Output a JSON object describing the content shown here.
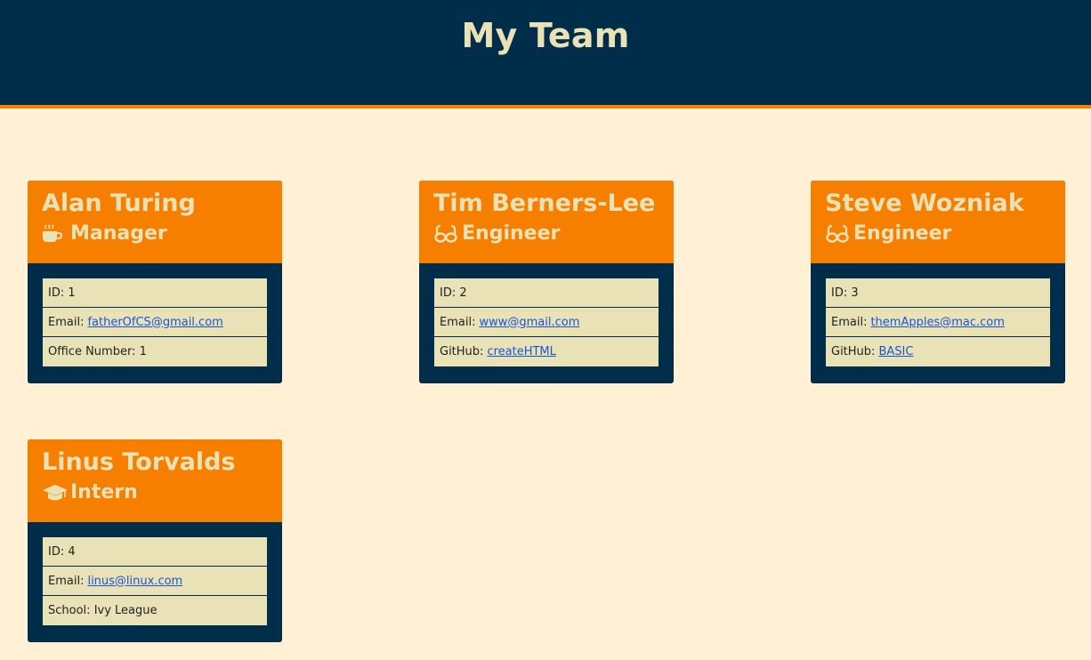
{
  "page": {
    "title": "My Team"
  },
  "employees": [
    {
      "name": "Alan Turing",
      "role": "Manager",
      "icon": "coffee-icon",
      "id_label": "ID:",
      "id": "1",
      "email_label": "Email:",
      "email": "fatherOfCS@gmail.com",
      "extra_label": "Office Number:",
      "extra": "1"
    },
    {
      "name": "Tim Berners-Lee",
      "role": "Engineer",
      "icon": "glasses-icon",
      "id_label": "ID:",
      "id": "2",
      "email_label": "Email:",
      "email": "www@gmail.com",
      "extra_label": "GitHub:",
      "extra": "createHTML"
    },
    {
      "name": "Steve Wozniak",
      "role": "Engineer",
      "icon": "glasses-icon",
      "id_label": "ID:",
      "id": "3",
      "email_label": "Email:",
      "email": "themApples@mac.com",
      "extra_label": "GitHub:",
      "extra": "BASIC"
    },
    {
      "name": "Linus Torvalds",
      "role": "Intern",
      "icon": "graduation-cap-icon",
      "id_label": "ID:",
      "id": "4",
      "email_label": "Email:",
      "email": "linus@linux.com",
      "extra_label": "School:",
      "extra": "Ivy League"
    }
  ],
  "colors": {
    "header_bg": "#002d4a",
    "accent": "#f77f00",
    "text_light": "#eae2b7",
    "page_bg": "#fff0d6",
    "link": "#1a55d8"
  }
}
